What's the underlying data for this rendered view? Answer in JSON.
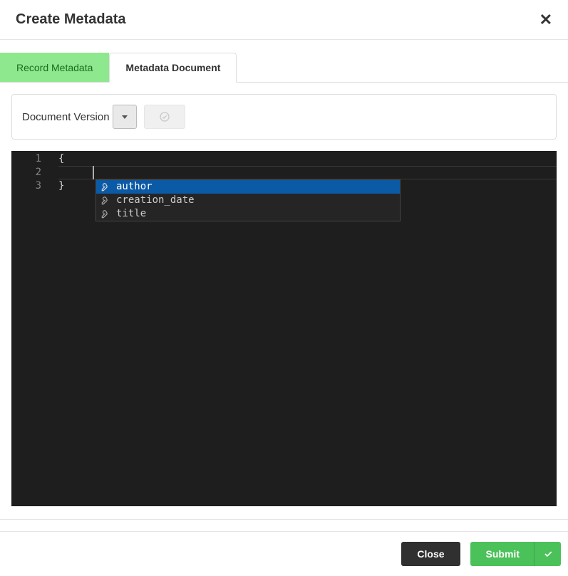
{
  "header": {
    "title": "Create Metadata"
  },
  "tabs": {
    "record": "Record Metadata",
    "document": "Metadata Document"
  },
  "toolbar": {
    "version_label": "Document Version"
  },
  "editor": {
    "lines": [
      "{",
      "",
      "}"
    ],
    "line_numbers": [
      "1",
      "2",
      "3"
    ],
    "suggestions": [
      {
        "label": "author",
        "kind": "property"
      },
      {
        "label": "creation_date",
        "kind": "property"
      },
      {
        "label": "title",
        "kind": "property"
      }
    ],
    "selected_suggestion_index": 0
  },
  "footer": {
    "close": "Close",
    "submit": "Submit"
  },
  "colors": {
    "tab_inactive_bg": "#8ee88e",
    "submit_bg": "#4bc15a",
    "suggest_selected_bg": "#0b5aa6"
  }
}
